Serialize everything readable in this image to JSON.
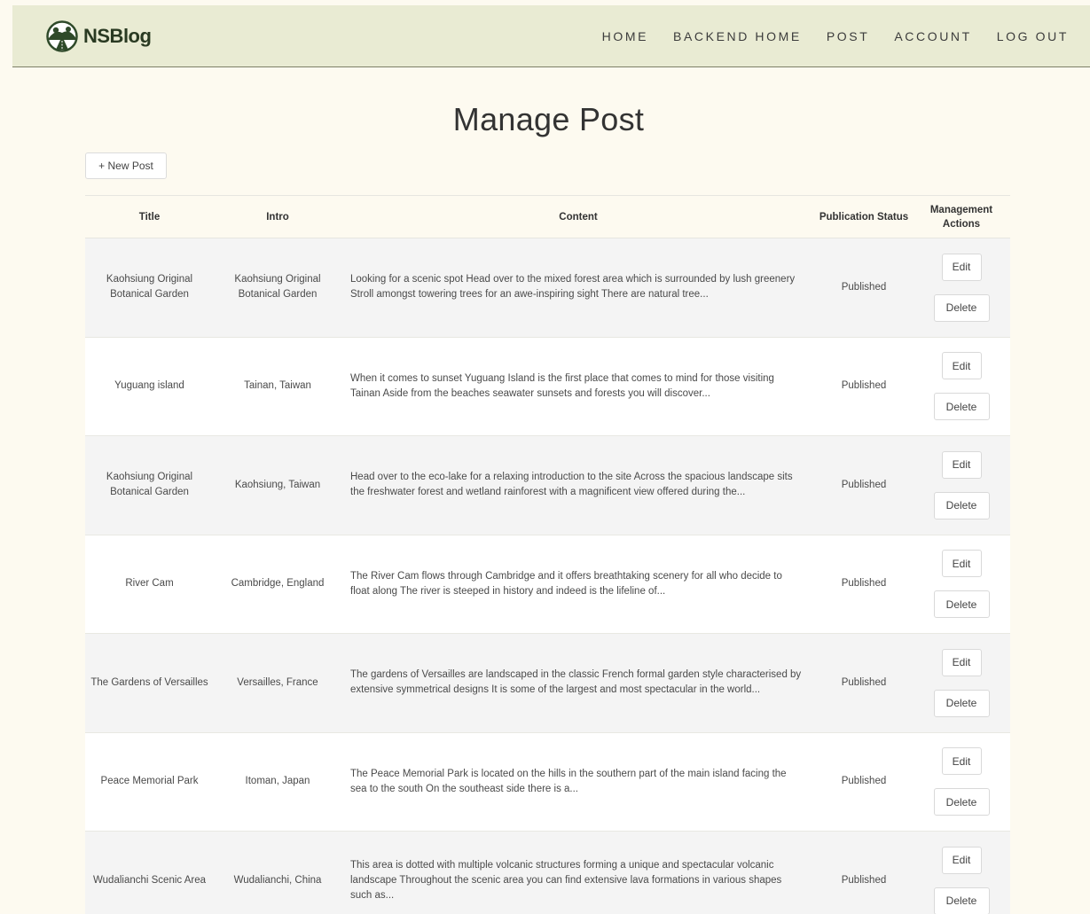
{
  "brand": {
    "name": "NSBlog",
    "logo_icon": "hill-road-logo-icon"
  },
  "nav": [
    "HOME",
    "BACKEND HOME",
    "POST",
    "ACCOUNT",
    "LOG OUT"
  ],
  "page": {
    "title": "Manage Post",
    "new_post_label": "+ New Post"
  },
  "table": {
    "headers": {
      "title": "Title",
      "intro": "Intro",
      "content": "Content",
      "status": "Publication Status",
      "actions": "Management Actions"
    },
    "edit_label": "Edit",
    "delete_label": "Delete",
    "rows": [
      {
        "title": "Kaohsiung Original Botanical Garden",
        "intro": "Kaohsiung Original Botanical Garden",
        "content": "Looking for a scenic spot Head over to the mixed forest area which is surrounded by lush greenery Stroll amongst towering trees for an awe-inspiring sight There are natural tree...",
        "status": "Published"
      },
      {
        "title": "Yuguang island",
        "intro": "Tainan, Taiwan",
        "content": "When it comes to sunset Yuguang Island is the first place that comes to mind for those visiting Tainan Aside from the beaches seawater sunsets and forests you will discover...",
        "status": "Published"
      },
      {
        "title": "Kaohsiung Original Botanical Garden",
        "intro": "Kaohsiung, Taiwan",
        "content": "Head over to the eco-lake for a relaxing introduction to the site Across the spacious landscape sits the freshwater forest and wetland rainforest with a magnificent view offered during the...",
        "status": "Published"
      },
      {
        "title": "River Cam",
        "intro": "Cambridge, England",
        "content": "The River Cam flows through Cambridge and it offers breathtaking scenery for all who decide to float along The river is steeped in history and indeed is the lifeline of...",
        "status": "Published"
      },
      {
        "title": "The Gardens of Versailles",
        "intro": "Versailles, France",
        "content": "The gardens of Versailles are landscaped in the classic French formal garden style characterised by extensive symmetrical designs It is some of the largest and most spectacular in the world...",
        "status": "Published"
      },
      {
        "title": "Peace Memorial Park",
        "intro": "Itoman, Japan",
        "content": "The Peace Memorial Park is located on the hills in the southern part of the main island facing the sea to the south On the southeast side there is a...",
        "status": "Published"
      },
      {
        "title": "Wudalianchi Scenic Area",
        "intro": "Wudalianchi, China",
        "content": "This area is dotted with multiple volcanic structures forming a unique and spectacular volcanic landscape Throughout the scenic area you can find extensive lava formations in various shapes such as...",
        "status": "Published"
      }
    ]
  }
}
